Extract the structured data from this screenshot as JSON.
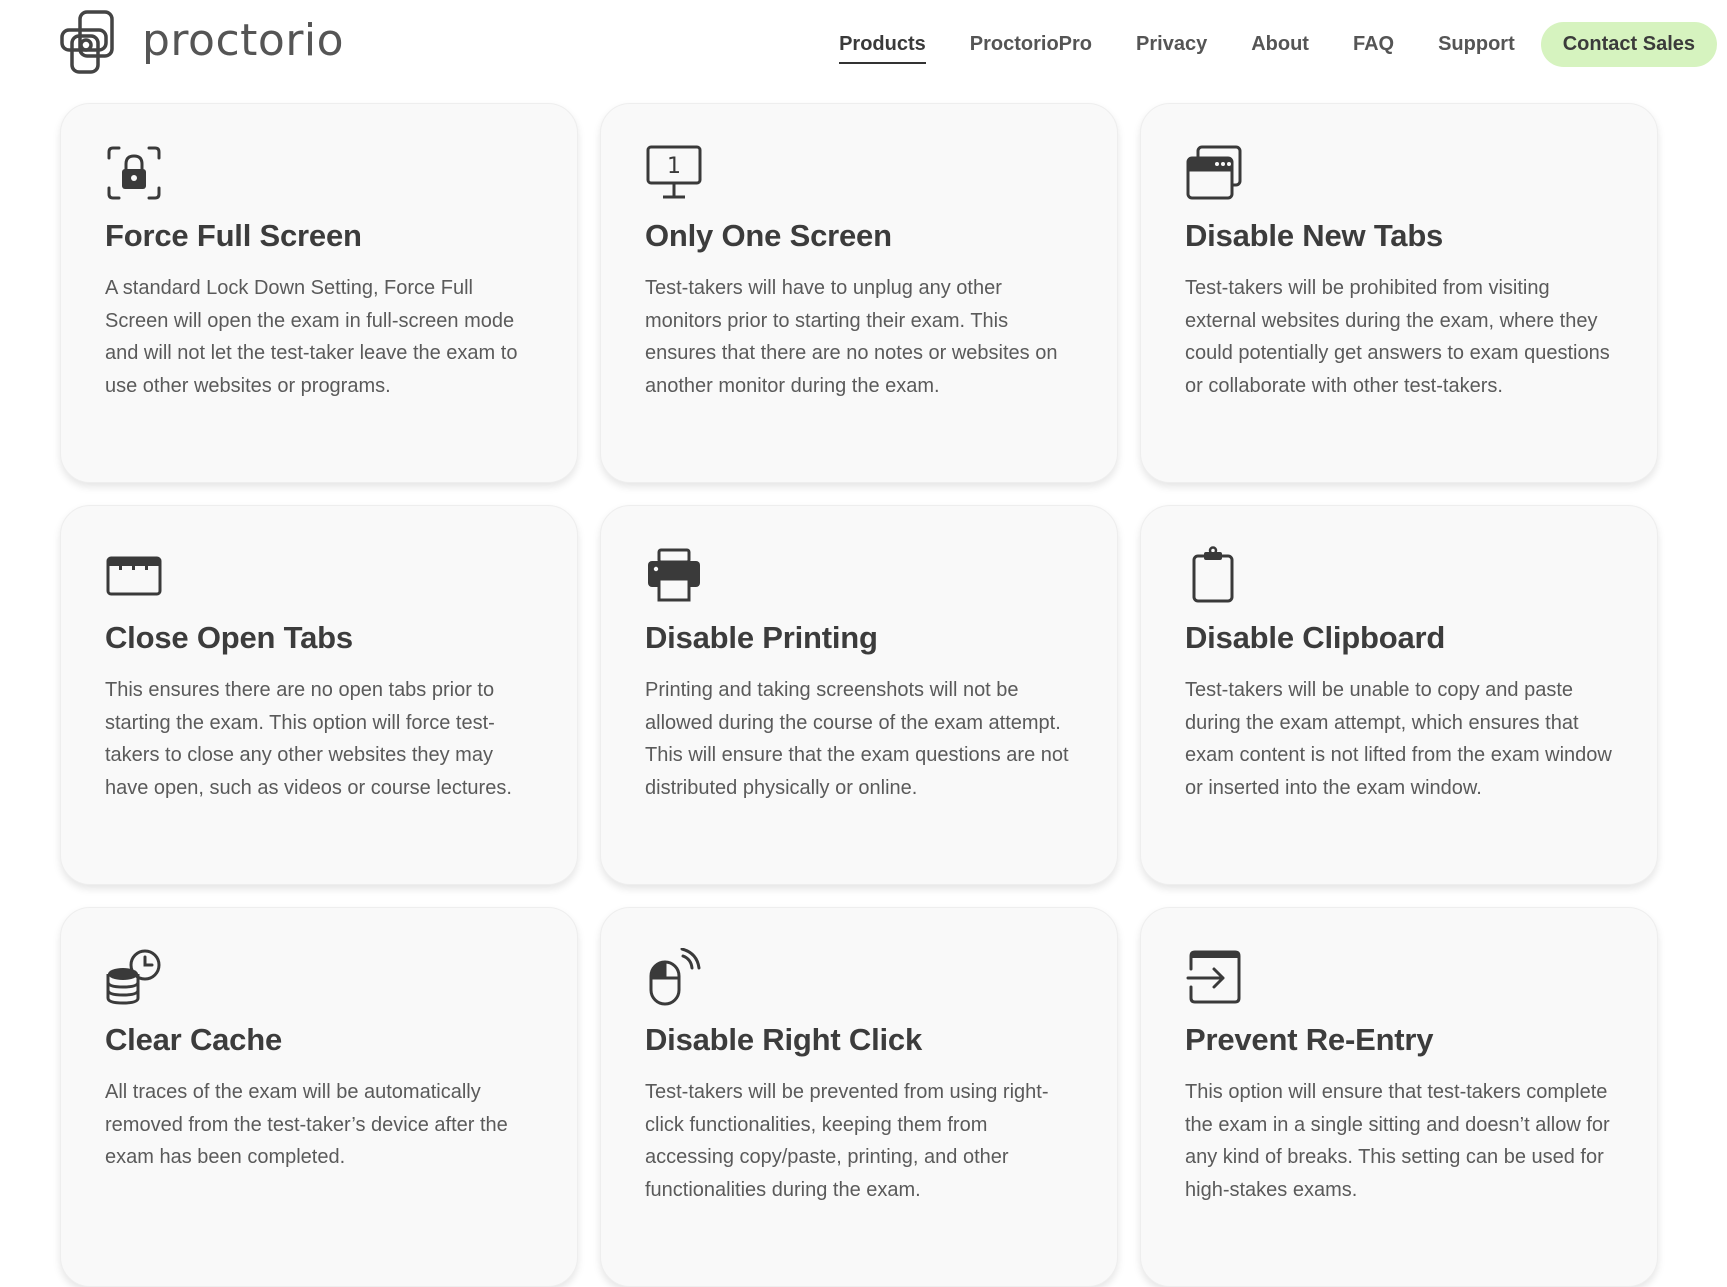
{
  "brand": {
    "name": "proctorio"
  },
  "nav": {
    "items": [
      {
        "label": "Products",
        "active": true
      },
      {
        "label": "ProctorioPro"
      },
      {
        "label": "Privacy"
      },
      {
        "label": "About"
      },
      {
        "label": "FAQ"
      },
      {
        "label": "Support"
      }
    ],
    "cta_label": "Contact Sales",
    "cta_color": "#d6f3bf"
  },
  "cards": [
    {
      "icon": "lock-screen-icon",
      "title": "Force Full Screen",
      "desc": "A standard Lock Down Setting, Force Full Screen will open the exam in full-screen mode and will not let the test-taker leave the exam to use other websites or programs."
    },
    {
      "icon": "single-monitor-icon",
      "icon_label": "1",
      "title": "Only One Screen",
      "desc": "Test-takers will have to unplug any other monitors prior to starting their exam. This ensures that there are no notes or websites on another monitor during the exam."
    },
    {
      "icon": "browser-windows-icon",
      "title": "Disable New Tabs",
      "desc": "Test-takers will be prohibited from visiting external websites during the exam, where they could potentially get answers to exam questions or collaborate with other test-takers."
    },
    {
      "icon": "browser-tabs-icon",
      "title": "Close Open Tabs",
      "desc": "This ensures there are no open tabs prior to starting the exam. This option will force test-takers to close any other websites they may have open, such as videos or course lectures."
    },
    {
      "icon": "printer-icon",
      "title": "Disable Printing",
      "desc": "Printing and taking screenshots will not be allowed during the course of the exam attempt. This will ensure that the exam questions are not distributed physically or online."
    },
    {
      "icon": "clipboard-icon",
      "title": "Disable Clipboard",
      "desc": "Test-takers will be unable to copy and paste during the exam attempt, which ensures that exam content is not lifted from the exam window or inserted into the exam window."
    },
    {
      "icon": "database-clock-icon",
      "title": "Clear Cache",
      "desc": "All traces of the exam will be automatically removed from the test-taker’s device after the exam has been completed."
    },
    {
      "icon": "mouse-click-icon",
      "title": "Disable Right Click",
      "desc": "Test-takers will be prevented from using right-click functionalities, keeping them from accessing copy/paste, printing, and other functionalities during the exam."
    },
    {
      "icon": "window-enter-icon",
      "title": "Prevent Re-Entry",
      "desc": "This option will ensure that test-takers complete the exam in a single sitting and doesn’t allow for any kind of breaks. This setting can be used for high-stakes exams."
    }
  ]
}
